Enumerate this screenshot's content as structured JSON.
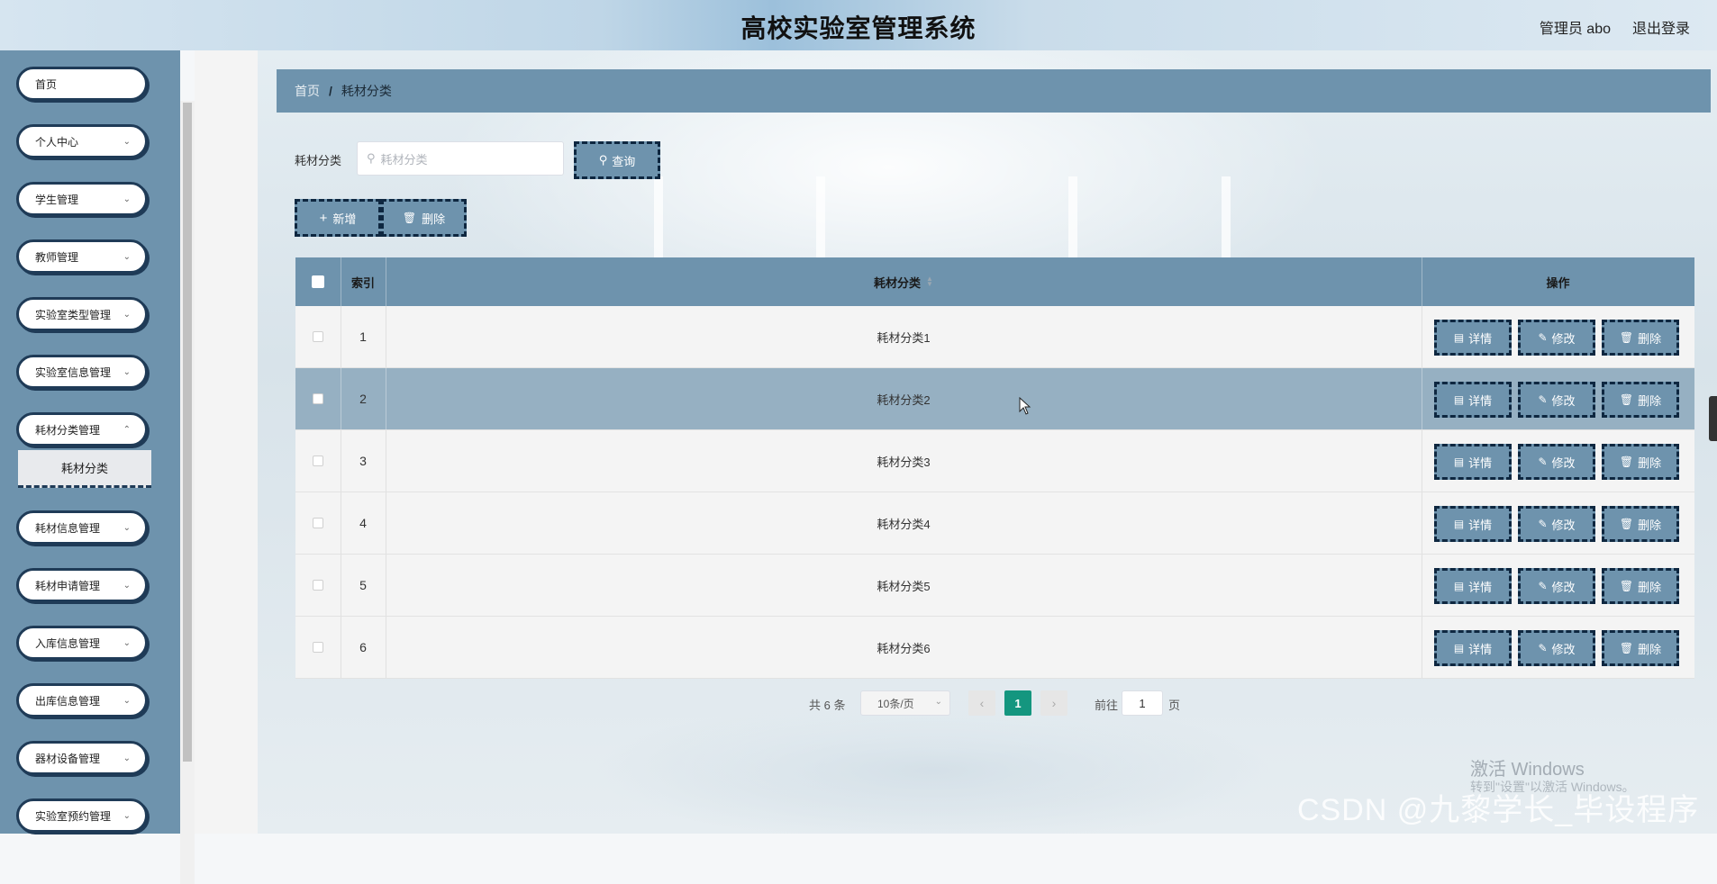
{
  "header": {
    "title": "高校实验室管理系统",
    "user_label": "管理员 abo",
    "logout_label": "退出登录"
  },
  "sidebar": {
    "items": [
      {
        "label": "首页",
        "has_chevron": false
      },
      {
        "label": "个人中心",
        "has_chevron": true
      },
      {
        "label": "学生管理",
        "has_chevron": true
      },
      {
        "label": "教师管理",
        "has_chevron": true
      },
      {
        "label": "实验室类型管理",
        "has_chevron": true
      },
      {
        "label": "实验室信息管理",
        "has_chevron": true
      },
      {
        "label": "耗材分类管理",
        "has_chevron": true,
        "expanded": true
      },
      {
        "label": "耗材信息管理",
        "has_chevron": true
      },
      {
        "label": "耗材申请管理",
        "has_chevron": true
      },
      {
        "label": "入库信息管理",
        "has_chevron": true
      },
      {
        "label": "出库信息管理",
        "has_chevron": true
      },
      {
        "label": "器材设备管理",
        "has_chevron": true
      },
      {
        "label": "实验室预约管理",
        "has_chevron": true
      }
    ],
    "sub_item": {
      "label": "耗材分类",
      "active": true
    }
  },
  "breadcrumb": {
    "home": "首页",
    "separator": "/",
    "current": "耗材分类"
  },
  "search": {
    "label": "耗材分类",
    "placeholder": "耗材分类",
    "value": "",
    "query_button": "查询"
  },
  "actions": {
    "add_label": "新增",
    "delete_label": "删除"
  },
  "table": {
    "columns": [
      "",
      "索引",
      "耗材分类",
      "操作"
    ],
    "sortable_column": "耗材分类",
    "rows": [
      {
        "index": "1",
        "name": "耗材分类1"
      },
      {
        "index": "2",
        "name": "耗材分类2",
        "highlighted": true
      },
      {
        "index": "3",
        "name": "耗材分类3"
      },
      {
        "index": "4",
        "name": "耗材分类4"
      },
      {
        "index": "5",
        "name": "耗材分类5"
      },
      {
        "index": "6",
        "name": "耗材分类6"
      }
    ],
    "row_actions": {
      "detail": "详情",
      "edit": "修改",
      "delete": "删除"
    }
  },
  "pagination": {
    "total_text": "共 6 条",
    "page_size": "10条/页",
    "current_page": "1",
    "goto_label": "前往",
    "goto_value": "1",
    "page_suffix": "页"
  },
  "overlays": {
    "windows_activation": "激活 Windows",
    "windows_activation_sub": "转到\"设置\"以激活 Windows。",
    "csdn_watermark": "CSDN @九黎学长_毕设程序"
  },
  "colors": {
    "primary": "#6e93ad",
    "border_dark": "#0e2740",
    "highlight_row": "#96b0c2",
    "page_active": "#14967f"
  }
}
